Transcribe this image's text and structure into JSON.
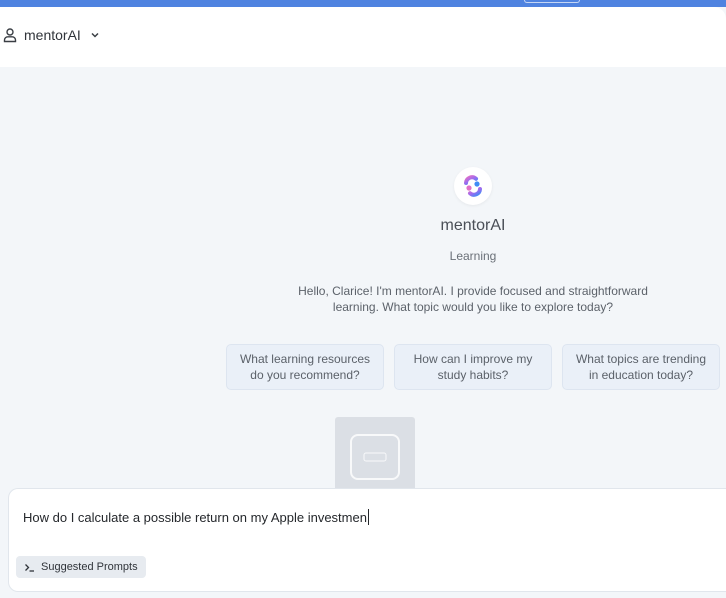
{
  "header": {
    "app_name": "mentorAI",
    "user_icon": "user-icon",
    "chevron_icon": "chevron-down-icon"
  },
  "hero": {
    "logo_icon": "mentorai-logo-icon",
    "title": "mentorAI",
    "subtitle": "Learning",
    "greeting": "Hello, Clarice! I'm mentorAI. I provide focused and straightforward learning. What topic would you like to explore today?"
  },
  "suggestions": [
    {
      "label": "What learning resources do you recommend?"
    },
    {
      "label": "How can I improve my study habits?"
    },
    {
      "label": "What topics are trending in education today?"
    }
  ],
  "composer": {
    "value": "How do I calculate a possible return on my Apple investmen",
    "suggested_prompts_label": "Suggested Prompts",
    "terminal_icon": "terminal-icon"
  },
  "colors": {
    "accent": "#4f83e0",
    "background": "#f3f6f9",
    "card": "#eaf0f8"
  }
}
